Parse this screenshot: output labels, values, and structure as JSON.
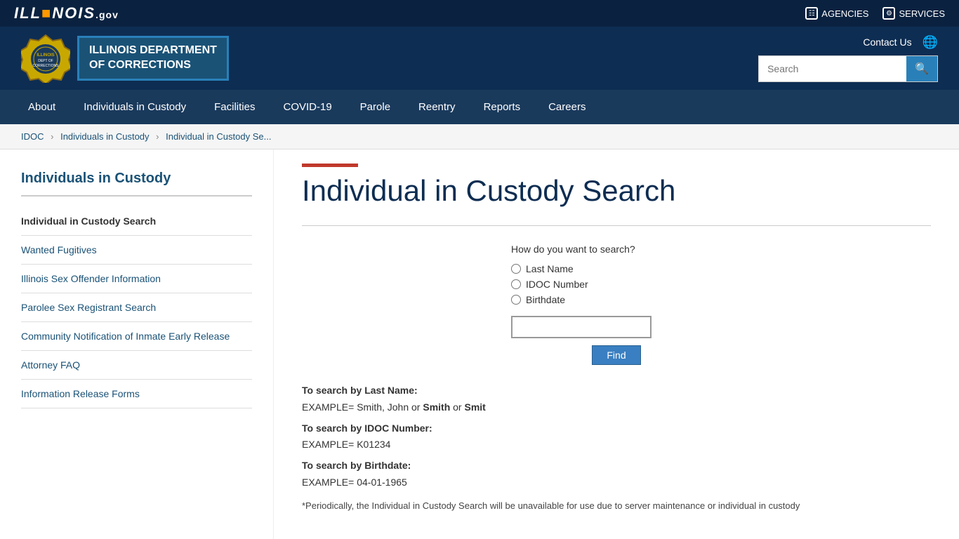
{
  "topbar": {
    "logo_ill": "ILL",
    "logo_inois": "INOIS",
    "logo_gov": ".gov",
    "agencies_label": "AGENCIES",
    "services_label": "SERVICES"
  },
  "header": {
    "dept_line1": "ILLINOIS DEPARTMENT",
    "dept_line2": "OF CORRECTIONS",
    "contact_label": "Contact Us",
    "search_placeholder": "Search"
  },
  "nav": {
    "items": [
      {
        "label": "About",
        "href": "#"
      },
      {
        "label": "Individuals in Custody",
        "href": "#"
      },
      {
        "label": "Facilities",
        "href": "#"
      },
      {
        "label": "COVID-19",
        "href": "#"
      },
      {
        "label": "Parole",
        "href": "#"
      },
      {
        "label": "Reentry",
        "href": "#"
      },
      {
        "label": "Reports",
        "href": "#"
      },
      {
        "label": "Careers",
        "href": "#"
      }
    ]
  },
  "breadcrumb": {
    "items": [
      {
        "label": "IDOC",
        "href": "#"
      },
      {
        "label": "Individuals in Custody",
        "href": "#"
      },
      {
        "label": "Individual in Custody Se...",
        "href": "#"
      }
    ]
  },
  "sidebar": {
    "title": "Individuals in Custody",
    "active_item": "Individual in Custody Search",
    "links": [
      {
        "label": "Wanted Fugitives"
      },
      {
        "label": "Illinois Sex Offender Information"
      },
      {
        "label": "Parolee Sex Registrant Search"
      },
      {
        "label": "Community Notification of Inmate Early Release"
      },
      {
        "label": "Attorney FAQ"
      },
      {
        "label": "Information Release Forms"
      }
    ]
  },
  "main": {
    "page_title": "Individual in Custody Search",
    "search_how_label": "How do you want to search?",
    "radio_options": [
      {
        "label": "Last Name"
      },
      {
        "label": "IDOC Number"
      },
      {
        "label": "Birthdate"
      }
    ],
    "find_button_label": "Find",
    "instructions": [
      {
        "heading": "To search by Last Name:",
        "text": "EXAMPLE= Smith, John or Smith or Smit"
      },
      {
        "heading": "To search by IDOC Number:",
        "text": "EXAMPLE= K01234"
      },
      {
        "heading": "To search by Birthdate:",
        "text": "EXAMPLE= 04-01-1965"
      }
    ],
    "note": "*Periodically, the Individual in Custody Search will be unavailable for use due to server maintenance or individual in custody"
  }
}
